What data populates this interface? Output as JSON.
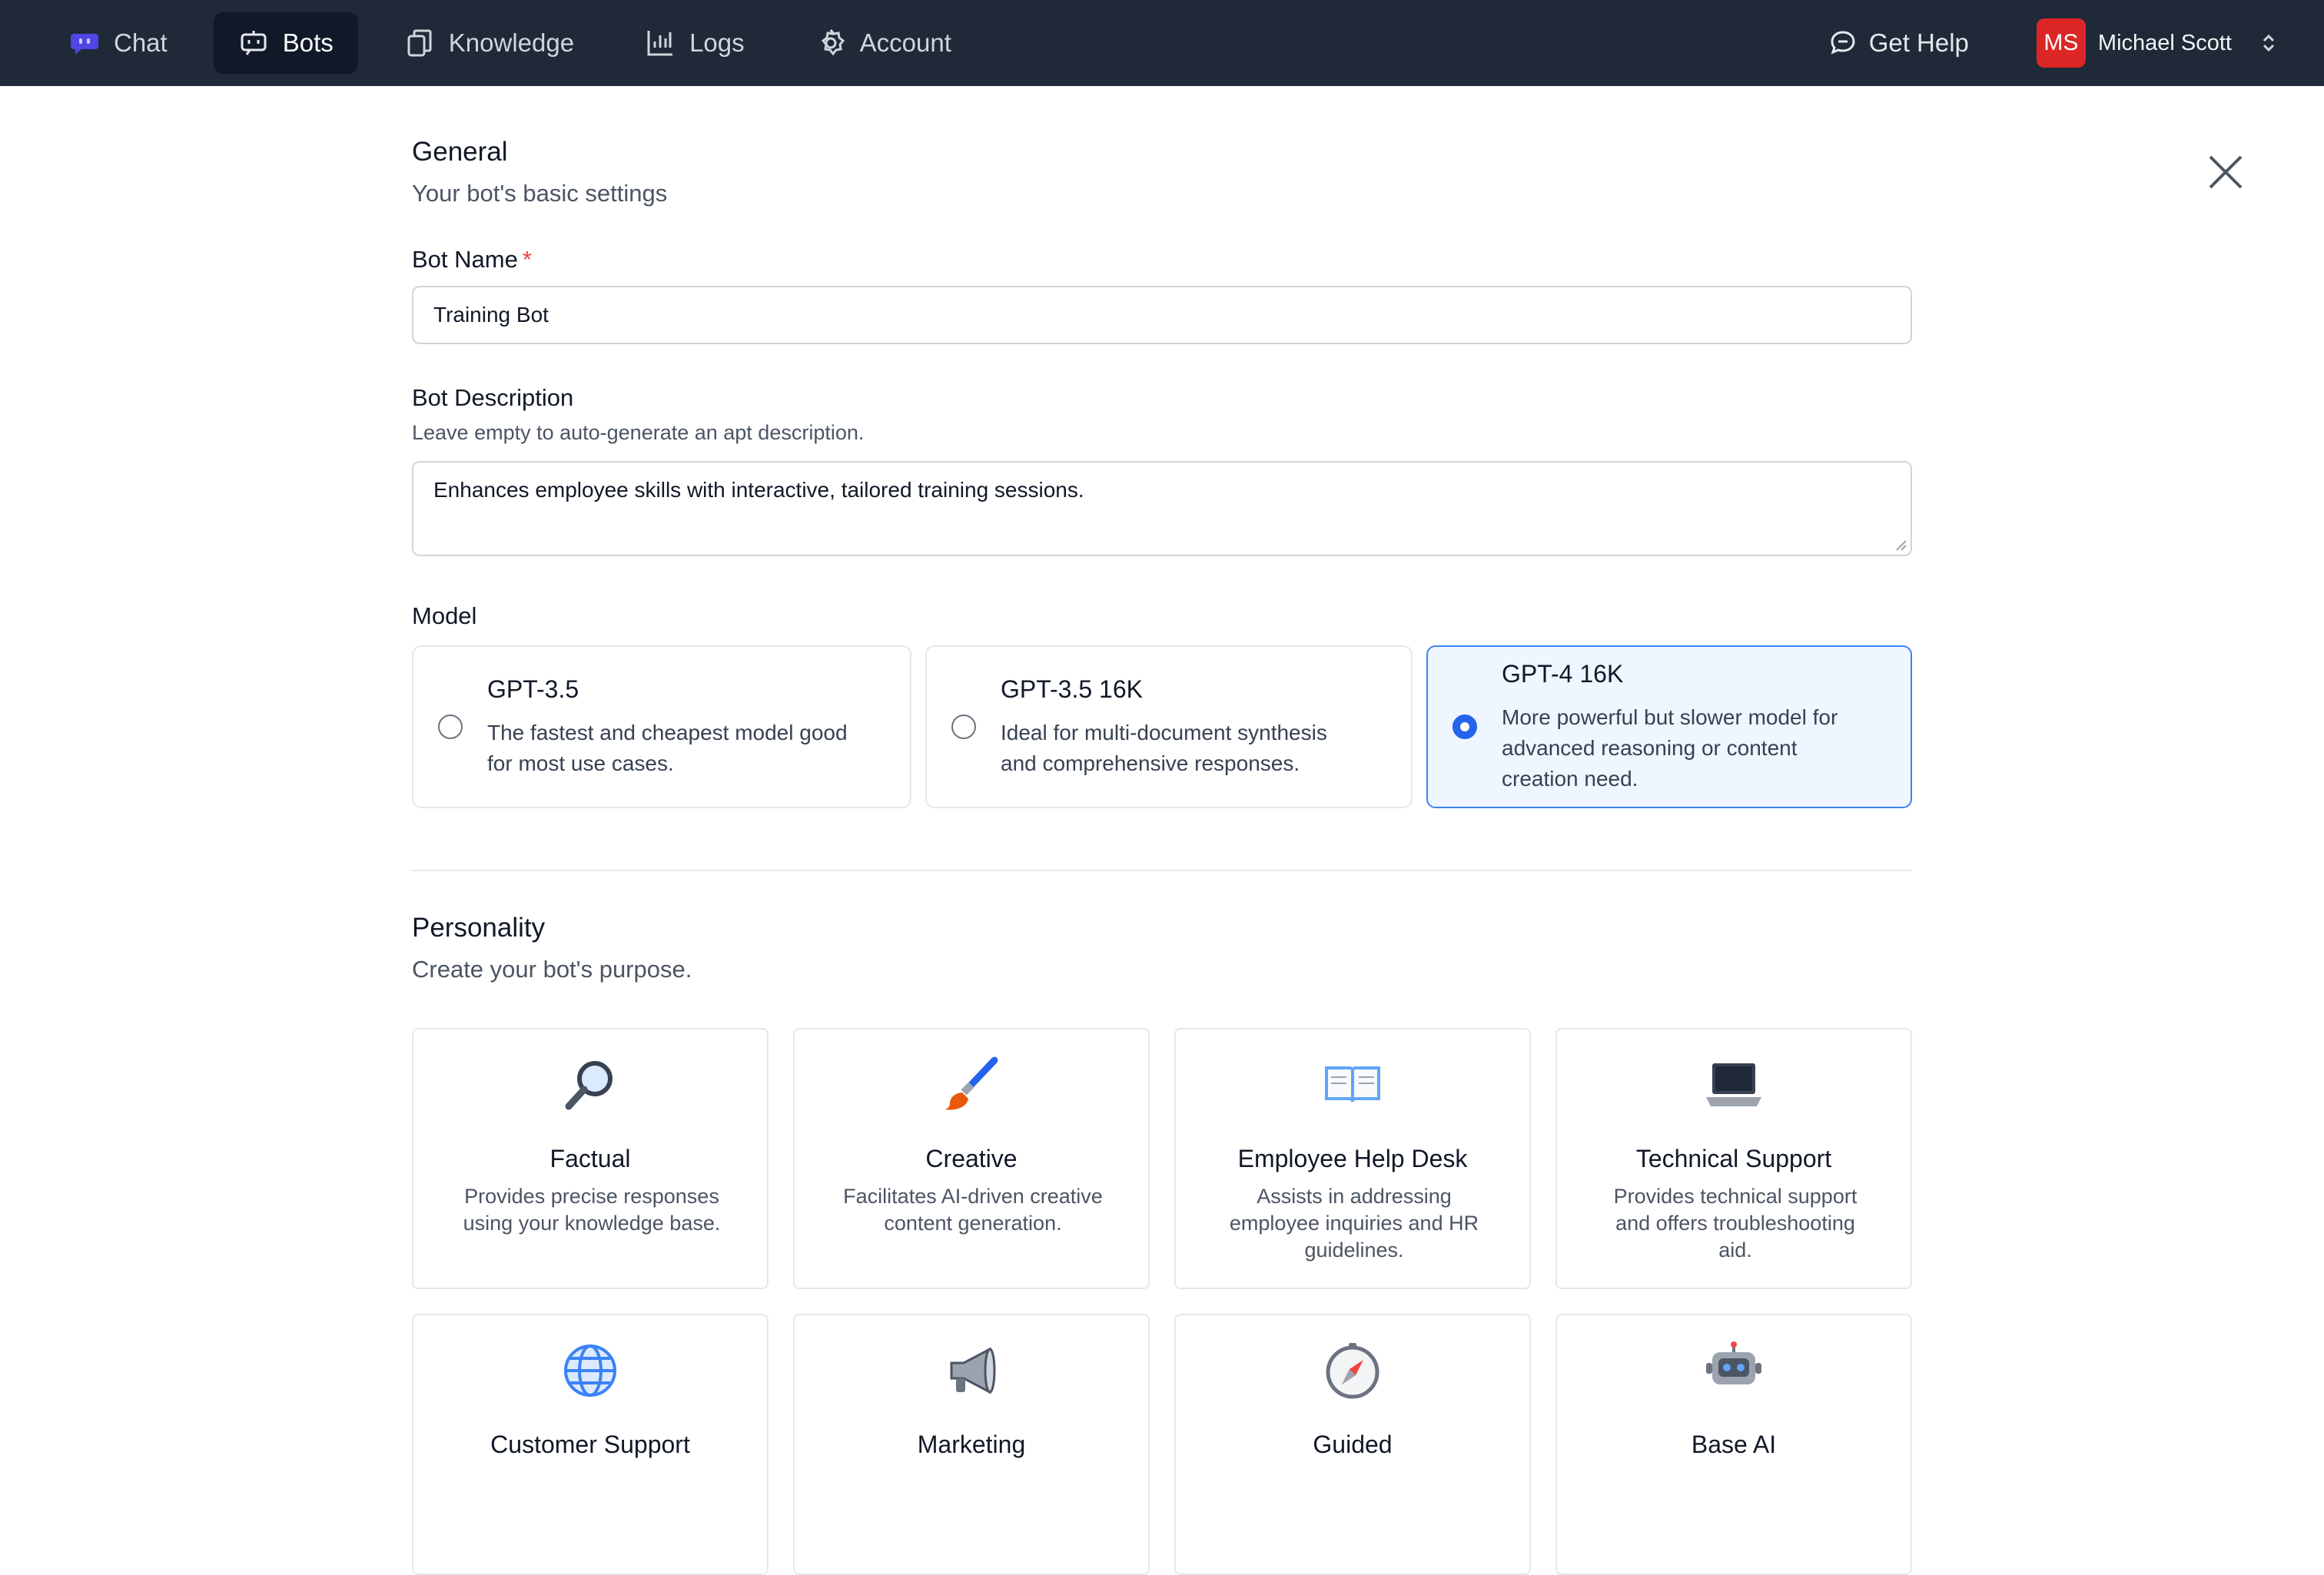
{
  "nav": {
    "items": [
      {
        "label": "Chat",
        "icon": "chat-bubble-icon",
        "active": false
      },
      {
        "label": "Bots",
        "icon": "bot-icon",
        "active": true
      },
      {
        "label": "Knowledge",
        "icon": "documents-icon",
        "active": false
      },
      {
        "label": "Logs",
        "icon": "bar-chart-icon",
        "active": false
      },
      {
        "label": "Account",
        "icon": "gear-icon",
        "active": false
      }
    ],
    "help_label": "Get Help",
    "user": {
      "initials": "MS",
      "name": "Michael Scott"
    }
  },
  "general": {
    "title": "General",
    "subtitle": "Your bot's basic settings",
    "bot_name_label": "Bot Name",
    "required_mark": "*",
    "bot_name_value": "Training Bot",
    "bot_desc_label": "Bot Description",
    "bot_desc_hint": "Leave empty to auto-generate an apt description.",
    "bot_desc_value": "Enhances employee skills with interactive, tailored training sessions.",
    "model_label": "Model",
    "models": [
      {
        "name": "GPT-3.5",
        "line1": "The fastest and cheapest model good",
        "line2": "for most use cases.",
        "line3": "",
        "selected": false
      },
      {
        "name": "GPT-3.5 16K",
        "line1": "Ideal for multi-document synthesis",
        "line2": "and comprehensive responses.",
        "line3": "",
        "selected": false
      },
      {
        "name": "GPT-4 16K",
        "line1": "More powerful but slower model for",
        "line2": "advanced reasoning or content",
        "line3": "creation need.",
        "selected": true
      }
    ]
  },
  "personality": {
    "title": "Personality",
    "subtitle": "Create your bot's purpose.",
    "cards": [
      {
        "title": "Factual",
        "icon": "magnifier-icon",
        "line1": "Provides precise responses",
        "line2": "using your knowledge base.",
        "line3": ""
      },
      {
        "title": "Creative",
        "icon": "paintbrush-icon",
        "line1": "Facilitates AI-driven creative",
        "line2": "content generation.",
        "line3": ""
      },
      {
        "title": "Employee Help Desk",
        "icon": "open-book-icon",
        "line1": "Assists in addressing",
        "line2": "employee inquiries and HR",
        "line3": "guidelines."
      },
      {
        "title": "Technical Support",
        "icon": "laptop-icon",
        "line1": "Provides technical support",
        "line2": "and offers troubleshooting",
        "line3": "aid."
      },
      {
        "title": "Customer Support",
        "icon": "globe-icon",
        "line1": "",
        "line2": "",
        "line3": ""
      },
      {
        "title": "Marketing",
        "icon": "megaphone-icon",
        "line1": "",
        "line2": "",
        "line3": ""
      },
      {
        "title": "Guided",
        "icon": "compass-icon",
        "line1": "",
        "line2": "",
        "line3": ""
      },
      {
        "title": "Base AI",
        "icon": "robot-icon",
        "line1": "",
        "line2": "",
        "line3": ""
      }
    ]
  },
  "colors": {
    "nav_bg": "#1f2937",
    "accent": "#2563eb",
    "selected_bg": "#eff6ff",
    "avatar": "#dc2626"
  }
}
